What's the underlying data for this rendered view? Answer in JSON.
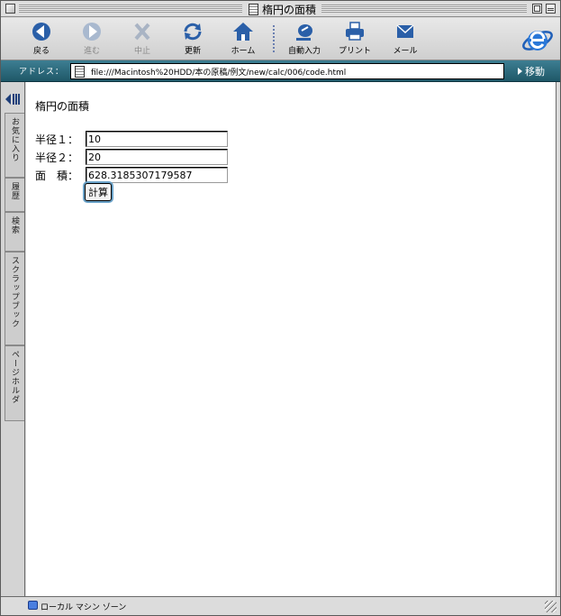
{
  "window": {
    "title": "楕円の面積"
  },
  "toolbar": {
    "back": "戻る",
    "forward": "進む",
    "stop": "中止",
    "refresh": "更新",
    "home": "ホーム",
    "autofill": "自動入力",
    "print": "プリント",
    "mail": "メール"
  },
  "address": {
    "label": "アドレス：",
    "url": "file:///Macintosh%20HDD/本の原稿/例文/new/calc/006/code.html",
    "go": "移動"
  },
  "sidebar": {
    "tabs": [
      "お気に入り",
      "履歴",
      "検索",
      "スクラップブック",
      "ページホルダ"
    ]
  },
  "page": {
    "heading": "楕円の面積",
    "radius1_label": "半径１：",
    "radius1_value": "10",
    "radius2_label": "半径２：",
    "radius2_value": "20",
    "area_label": "面　積：",
    "area_value": "628.3185307179587",
    "calc_button": "計算"
  },
  "status": {
    "zone": "ローカル マシン ゾーン"
  },
  "colors": {
    "address_bar": "#2f6f82",
    "accent": "#1f5fb8",
    "focus_ring": "#6aa2c8"
  }
}
